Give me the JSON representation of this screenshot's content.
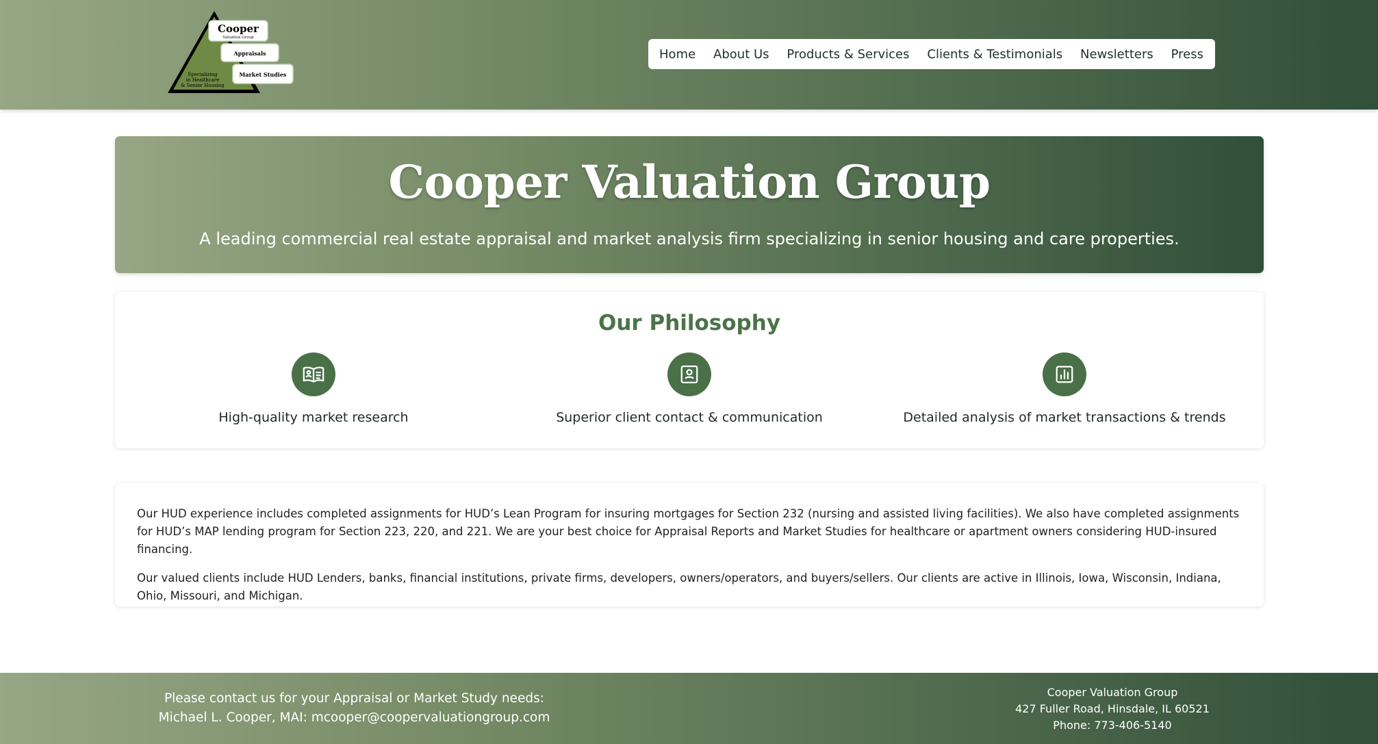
{
  "logo": {
    "name": "Cooper",
    "group": "Valuation Group",
    "tab1": "Appraisals",
    "tab2": "Market Studies",
    "tagline": [
      "Specializing",
      "in Healthcare",
      "& Senior Housing"
    ]
  },
  "nav": {
    "items": [
      {
        "label": "Home"
      },
      {
        "label": "About Us"
      },
      {
        "label": "Products & Services"
      },
      {
        "label": "Clients & Testimonials"
      },
      {
        "label": "Newsletters"
      },
      {
        "label": "Press"
      }
    ]
  },
  "hero": {
    "title": "Cooper Valuation Group",
    "subtitle": "A leading commercial real estate appraisal and market analysis firm specializing in senior housing and care properties."
  },
  "philosophy": {
    "title": "Our Philosophy",
    "features": [
      {
        "icon": "open-book-icon",
        "label": "High-quality market research"
      },
      {
        "icon": "contact-card-icon",
        "label": "Superior client contact & communication"
      },
      {
        "icon": "bar-chart-icon",
        "label": "Detailed analysis of market transactions & trends"
      }
    ]
  },
  "body": {
    "paragraphs": [
      "Our HUD experience includes completed assignments for HUD’s Lean Program for insuring mortgages for Section 232 (nursing and assisted living facilities). We also have completed assignments for HUD’s MAP lending program for Section 223, 220, and 221. We are your best choice for Appraisal Reports and Market Studies for healthcare or apartment owners considering HUD-insured financing.",
      "Our valued clients include HUD Lenders, banks, financial institutions, private firms, developers, owners/operators, and buyers/sellers. Our clients are active in Illinois, Iowa, Wisconsin, Indiana, Ohio, Missouri, and Michigan."
    ]
  },
  "footer": {
    "contact_line": "Please contact us for your Appraisal or Market Study needs:",
    "contact_person": "Michael L. Cooper, MAI: mcooper@coopervaluationgroup.com",
    "company": "Cooper Valuation Group",
    "address": "427 Fuller Road, Hinsdale, IL 60521",
    "phone": "Phone: 773-406-5140"
  },
  "colors": {
    "gradient_start": "#97a684",
    "gradient_end": "#314f39",
    "accent_green": "#4a7048",
    "heading_green": "#4b7348"
  }
}
